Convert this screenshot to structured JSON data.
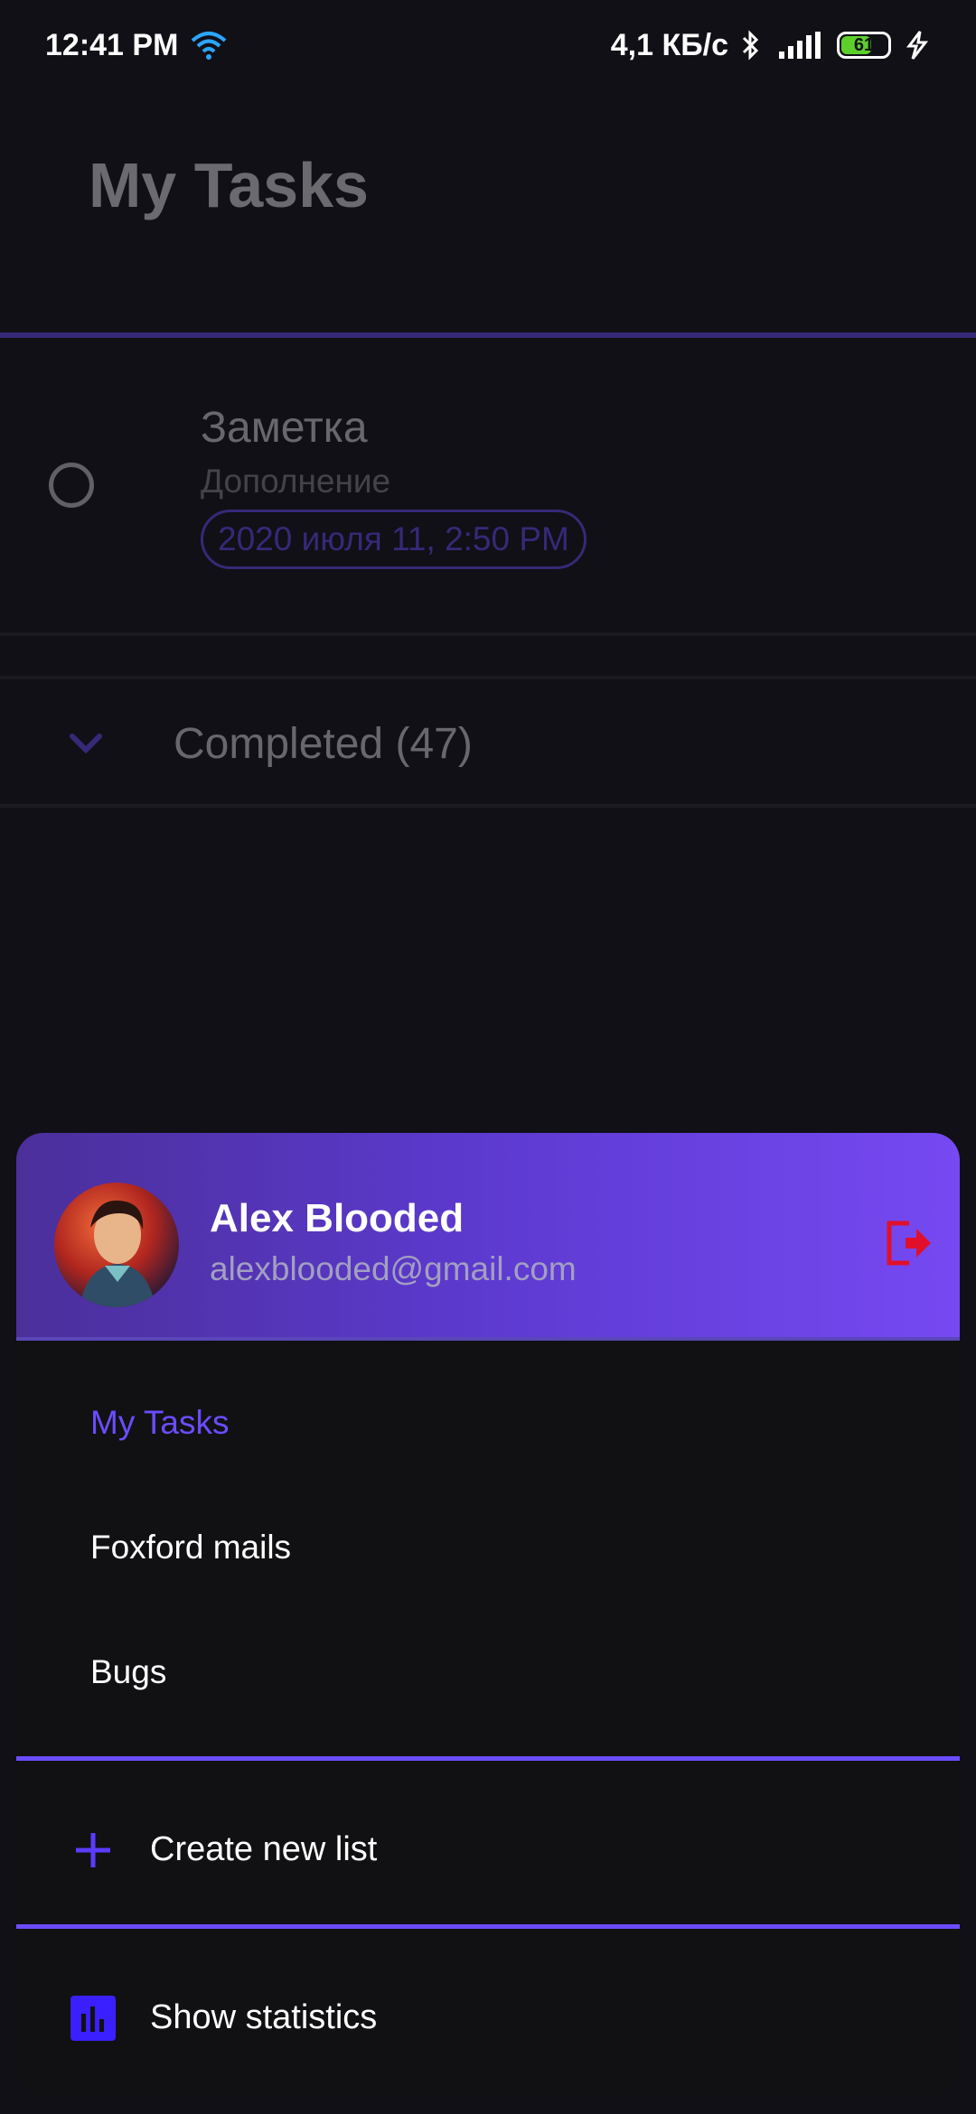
{
  "status_bar": {
    "time": "12:41 PM",
    "network_speed": "4,1 КБ/с",
    "battery": "61",
    "icons": [
      "wifi-icon",
      "bluetooth-icon",
      "signal-icon",
      "battery-icon",
      "charging-icon"
    ]
  },
  "app": {
    "title": "My Tasks",
    "accent_color": "#6b4cff"
  },
  "task": {
    "title": "Заметка",
    "notes": "Дополнение",
    "due_date": "2020 июля 11, 2:50 PM"
  },
  "completed": {
    "label": "Completed (47)"
  },
  "drawer": {
    "user": {
      "name": "Alex Blooded",
      "email": "alexblooded@gmail.com"
    },
    "lists": [
      {
        "label": "My Tasks",
        "active": true
      },
      {
        "label": "Foxford mails",
        "active": false
      },
      {
        "label": "Bugs",
        "active": false
      }
    ],
    "create_list_label": "Create new list",
    "show_statistics_label": "Show statistics"
  }
}
